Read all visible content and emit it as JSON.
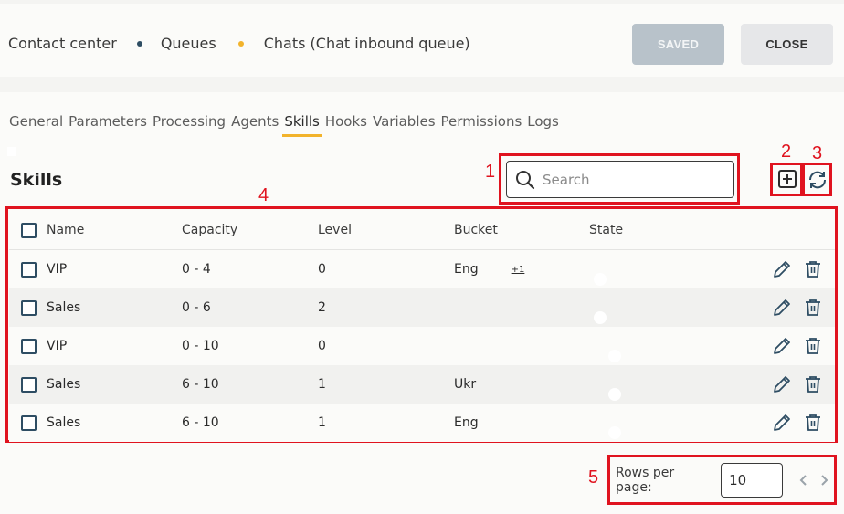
{
  "header": {
    "breadcrumb": [
      "Contact center",
      "Queues",
      "Chats (Chat inbound queue)"
    ],
    "saved_label": "SAVED",
    "close_label": "CLOSE"
  },
  "tabs": [
    "General",
    "Parameters",
    "Processing",
    "Agents",
    "Skills",
    "Hooks",
    "Variables",
    "Permissions",
    "Logs"
  ],
  "active_tab": "Skills",
  "section_title": "Skills",
  "search": {
    "placeholder": "Search",
    "value": ""
  },
  "annotations": [
    "1",
    "2",
    "3",
    "4",
    "5"
  ],
  "table": {
    "columns": [
      "Name",
      "Capacity",
      "Level",
      "Bucket",
      "State"
    ],
    "rows": [
      {
        "name": "VIP",
        "capacity": "0 - 4",
        "level": "0",
        "bucket": "Eng",
        "bucket_more": "+1",
        "state": false
      },
      {
        "name": "Sales",
        "capacity": "0 - 6",
        "level": "2",
        "bucket": "",
        "bucket_more": "",
        "state": false
      },
      {
        "name": "VIP",
        "capacity": "0 - 10",
        "level": "0",
        "bucket": "",
        "bucket_more": "",
        "state": true
      },
      {
        "name": "Sales",
        "capacity": "6 - 10",
        "level": "1",
        "bucket": "Ukr",
        "bucket_more": "",
        "state": true
      },
      {
        "name": "Sales",
        "capacity": "6 - 10",
        "level": "1",
        "bucket": "Eng",
        "bucket_more": "",
        "state": true
      }
    ]
  },
  "pagination": {
    "label": "Rows per page:",
    "rows_per_page": "10"
  },
  "colors": {
    "accent": "#f2b32c",
    "primary": "#2e4d63",
    "annotation_red": "#e0131f",
    "toggle_on": "#f6bf2c"
  }
}
